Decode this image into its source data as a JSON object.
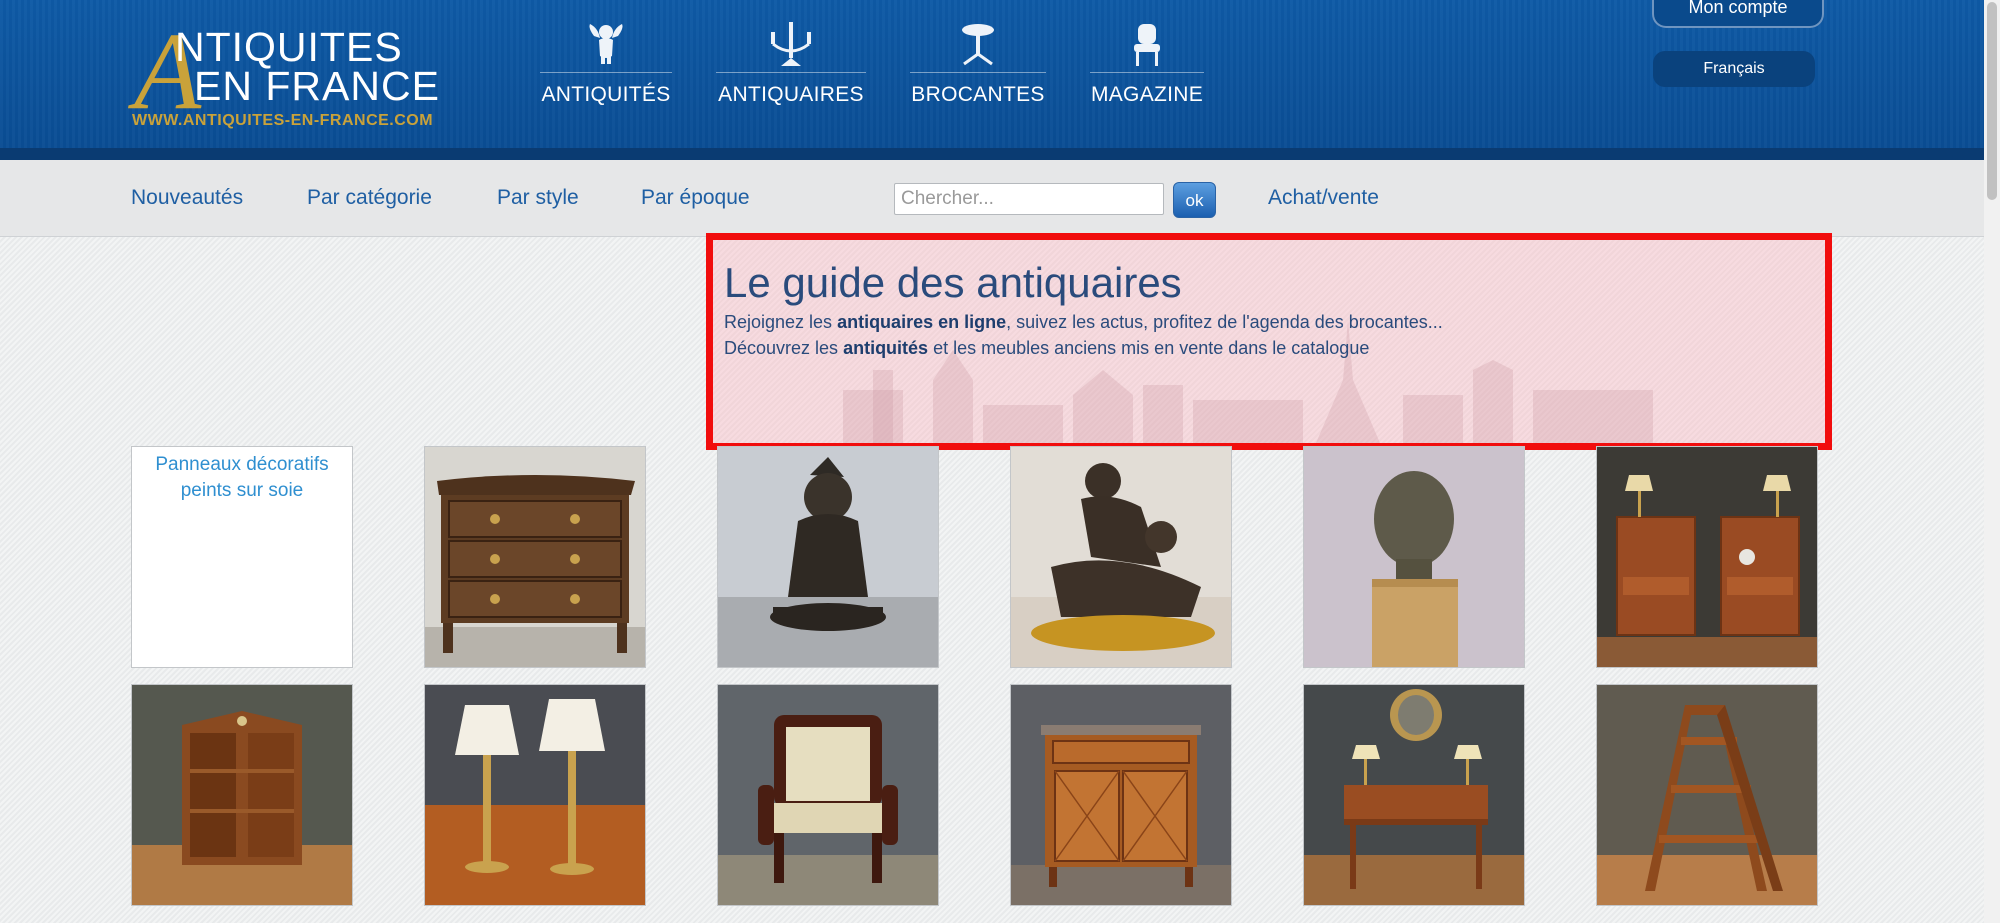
{
  "header": {
    "logo": {
      "letter": "A",
      "line1": "NTIQUITES",
      "line2": "EN FRANCE",
      "url": "WWW.ANTIQUITES-EN-FRANCE.COM"
    },
    "nav": [
      {
        "label": "ANTIQUITÉS",
        "icon": "cherub-icon"
      },
      {
        "label": "ANTIQUAIRES",
        "icon": "candelabra-icon"
      },
      {
        "label": "BROCANTES",
        "icon": "pedestal-table-icon"
      },
      {
        "label": "MAGAZINE",
        "icon": "armchair-icon"
      }
    ],
    "account": "Mon compte",
    "language": "Français"
  },
  "subnav": {
    "links": [
      "Nouveautés",
      "Par catégorie",
      "Par style",
      "Par époque"
    ],
    "search_placeholder": "Chercher...",
    "search_button": "ok",
    "buy_sell": "Achat/vente"
  },
  "guide": {
    "title": "Le guide des antiquaires",
    "line1_pre": "Rejoignez les ",
    "line1_bold": "antiquaires en ligne",
    "line1_post": ", suivez les actus, profitez de l'agenda des brocantes...",
    "line2_pre": "Découvrez les ",
    "line2_bold": "antiquités",
    "line2_post": " et les meubles anciens mis en vente dans le catalogue"
  },
  "products": {
    "broken_alt": "Panneaux décoratifs peints sur soie",
    "items": [
      "commode-image",
      "bronze-figure-image",
      "bronze-cherubs-image",
      "bronze-head-image",
      "nightstands-image",
      "revolving-bookcase-image",
      "table-lamps-image",
      "armchair-image",
      "marquetry-cabinet-image",
      "writing-desk-image",
      "library-ladder-image"
    ]
  },
  "colors": {
    "header_blue": "#0d58a4",
    "link_blue": "#1f5fa3",
    "gold": "#c9a23a",
    "highlight_red": "#f10d0d"
  }
}
